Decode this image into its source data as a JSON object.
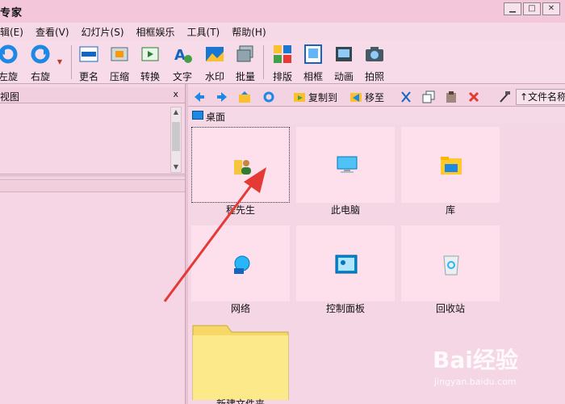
{
  "window": {
    "title": "专家",
    "min": "▁",
    "max": "□",
    "close": "✕"
  },
  "menu": [
    "辑(E)",
    "查看(V)",
    "幻灯片(S)",
    "相框娱乐",
    "工具(T)",
    "帮助(H)"
  ],
  "toolbar": {
    "rotate_left": "左旋",
    "rotate_right": "右旋",
    "rename": "更名",
    "compress": "压缩",
    "convert": "转换",
    "text": "文字",
    "watermark": "水印",
    "batch": "批量",
    "layout": "排版",
    "frame": "相框",
    "animation": "动画",
    "capture": "拍照"
  },
  "left_panel": {
    "title": "视图",
    "close": "x"
  },
  "file_toolbar": {
    "copy_to": "复制到",
    "move_to": "移至",
    "sort": "↑文件名称"
  },
  "path": {
    "current": "桌面"
  },
  "items": [
    {
      "label": "程先生",
      "icon": "user-folder-icon"
    },
    {
      "label": "此电脑",
      "icon": "computer-icon"
    },
    {
      "label": "库",
      "icon": "library-icon"
    },
    {
      "label": "网络",
      "icon": "network-icon"
    },
    {
      "label": "控制面板",
      "icon": "control-panel-icon"
    },
    {
      "label": "回收站",
      "icon": "recycle-bin-icon"
    },
    {
      "label": "新建文件夹",
      "icon": "folder-icon"
    }
  ],
  "watermark": {
    "brand": "Bai经验",
    "url": "jingyan.baidu.com"
  },
  "colors": {
    "window_bg": "#f4d6e4",
    "thumb_bg": "#fde0ec",
    "arrow": "#e53935"
  }
}
